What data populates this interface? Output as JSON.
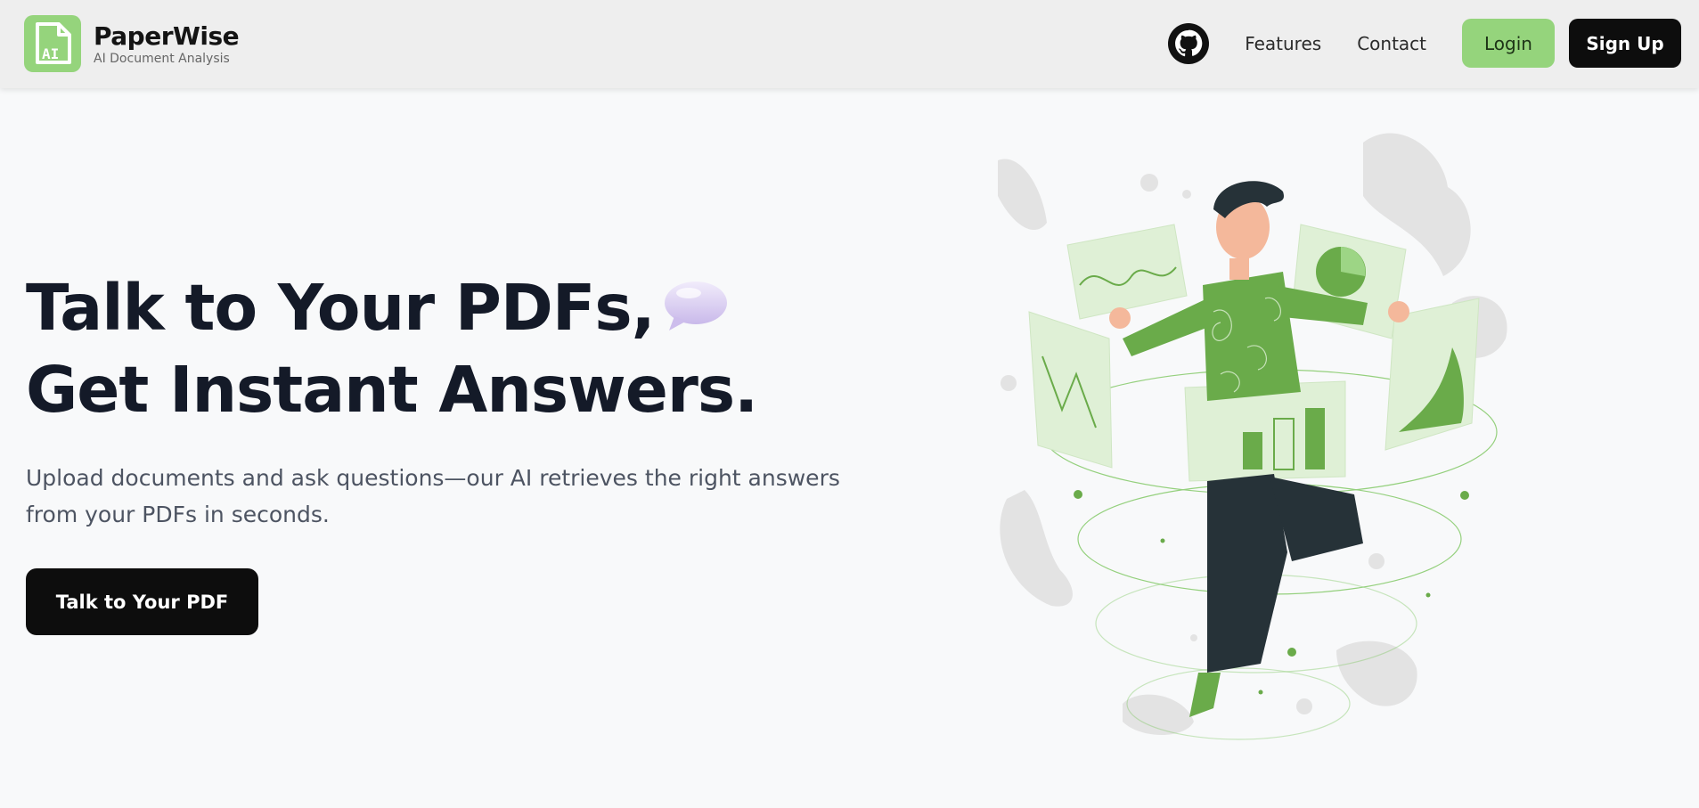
{
  "brand": {
    "name": "PaperWise",
    "tagline": "AI Document Analysis",
    "logo_text": "AI"
  },
  "nav": {
    "github_icon": "github-icon",
    "links": [
      "Features",
      "Contact"
    ],
    "login_label": "Login",
    "signup_label": "Sign Up"
  },
  "hero": {
    "line1": "Talk to Your PDFs,",
    "line2": "Get Instant Answers.",
    "bubble_icon": "speech-bubble-icon",
    "subtitle": "Upload documents and ask questions—our AI retrieves the right answers from your PDFs in seconds.",
    "cta_label": "Talk to Your PDF"
  },
  "colors": {
    "accent": "#95d47c",
    "dark": "#0d0d0d",
    "heading": "#141a28",
    "illustration_green": "#6aab4a"
  }
}
